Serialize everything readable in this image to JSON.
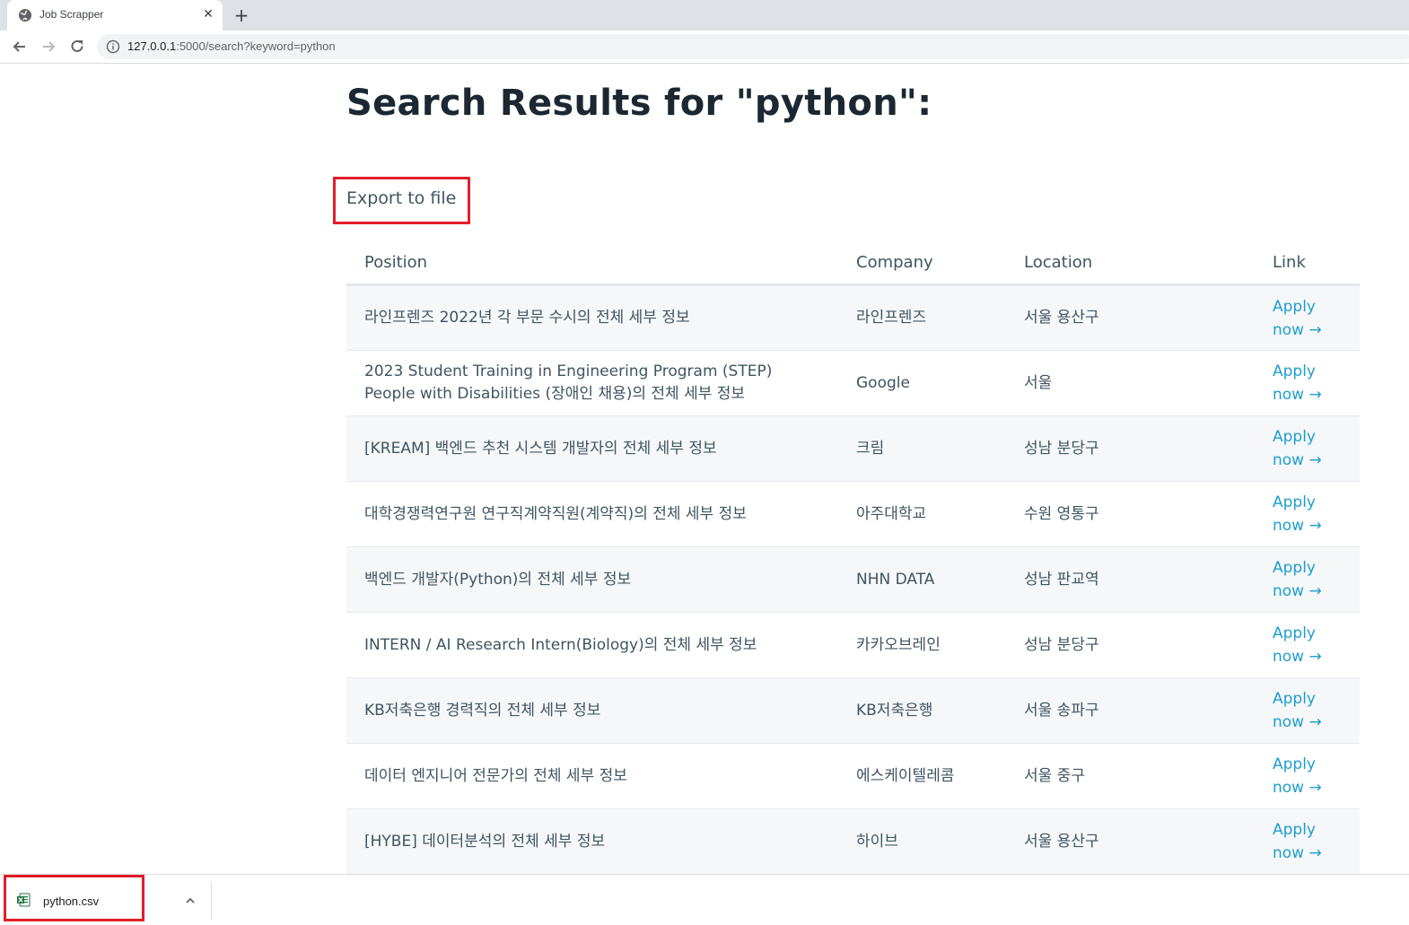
{
  "browser": {
    "tab_title": "Job Scrapper",
    "tab_close": "✕",
    "new_tab": "+",
    "url_host": "127.0.0.1",
    "url_path": ":5000/search?keyword=python"
  },
  "page": {
    "title": "Search Results for \"python\":",
    "export_label": "Export to file"
  },
  "table": {
    "headers": [
      "Position",
      "Company",
      "Location",
      "Link"
    ],
    "apply_line1": "Apply",
    "apply_line2": "now →",
    "rows": [
      {
        "position": "라인프렌즈 2022년 각 부문 수시의 전체 세부 정보",
        "company": "라인프렌즈",
        "location": "서울 용산구"
      },
      {
        "position": "2023 Student Training in Engineering Program (STEP) People with Disabilities (장애인 채용)의 전체 세부 정보",
        "company": "Google",
        "location": "서울"
      },
      {
        "position": "[KREAM] 백엔드 추천 시스템 개발자의 전체 세부 정보",
        "company": "크림",
        "location": "성남 분당구"
      },
      {
        "position": "대학경쟁력연구원 연구직계약직원(계약직)의 전체 세부 정보",
        "company": "아주대학교",
        "location": "수원 영통구"
      },
      {
        "position": "백엔드 개발자(Python)의 전체 세부 정보",
        "company": "NHN DATA",
        "location": "성남 판교역"
      },
      {
        "position": "INTERN / AI Research Intern(Biology)의 전체 세부 정보",
        "company": "카카오브레인",
        "location": "성남 분당구"
      },
      {
        "position": "KB저축은행 경력직의 전체 세부 정보",
        "company": "KB저축은행",
        "location": "서울 송파구"
      },
      {
        "position": "데이터 엔지니어 전문가의 전체 세부 정보",
        "company": "에스케이텔레콤",
        "location": "서울 중구"
      },
      {
        "position": "[HYBE] 데이터분석의 전체 세부 정보",
        "company": "하이브",
        "location": "서울 용산구"
      }
    ]
  },
  "downloads": {
    "file_name": "python.csv"
  },
  "colors": {
    "highlight": "#e31e2b",
    "link": "#1e9ecf",
    "text": "#415462",
    "heading": "#1b2731"
  },
  "icons": [
    "globe-icon",
    "close-icon",
    "plus-icon",
    "back-arrow-icon",
    "forward-arrow-icon",
    "reload-icon",
    "info-icon",
    "excel-file-icon",
    "chevron-up-icon"
  ]
}
